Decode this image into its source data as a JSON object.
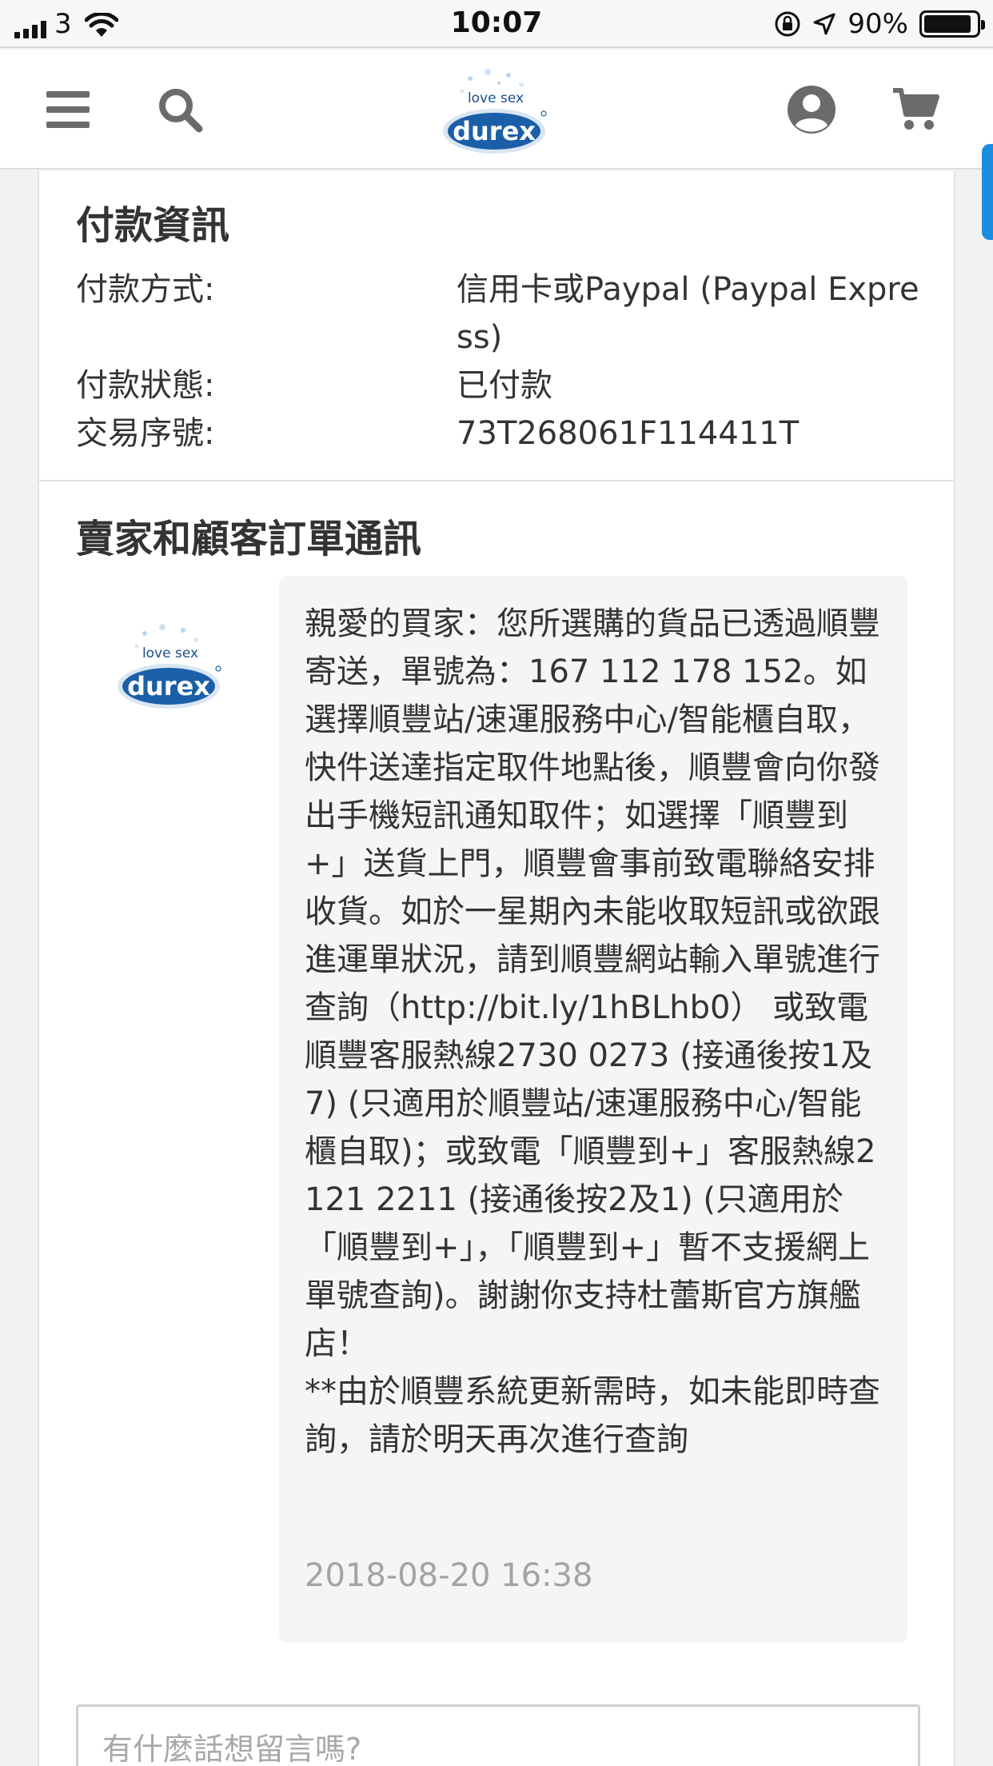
{
  "status_bar": {
    "carrier": "3",
    "time": "10:07",
    "battery_percent": "90%",
    "battery_level": 0.9
  },
  "header": {
    "logo": {
      "top_text": "love sex",
      "brand": "durex"
    },
    "icons": [
      "menu-icon",
      "search-icon",
      "account-icon",
      "cart-icon"
    ]
  },
  "payment": {
    "title": "付款資訊",
    "rows": [
      {
        "label": "付款方式:",
        "value": "信用卡或Paypal (Paypal Express)"
      },
      {
        "label": "付款狀態:",
        "value": "已付款"
      },
      {
        "label": "交易序號:",
        "value": "73T268061F114411T"
      }
    ]
  },
  "messages": {
    "title": "賣家和顧客訂單通訊",
    "avatar": {
      "top_text": "love sex",
      "brand": "durex"
    },
    "items": [
      {
        "text": " 親愛的買家：您所選購的貨品已透過順豐寄送，單號為：167 112 178 152。如選擇順豐站/速運服務中心/智能櫃自取，快件送達指定取件地點後，順豐會向你發出手機短訊通知取件；如選擇「順豐到+」送貨上門，順豐會事前致電聯絡安排收貨。如於一星期內未能收取短訊或欲跟進運單狀況，請到順豐網站輸入單號進行查詢（http://bit.ly/1hBLhb0） 或致電順豐客服熱線2730 0273 (接通後按1及7) (只適用於順豐站/速運服務中心/智能櫃自取)；或致電「順豐到+」客服熱線2121 2211 (接通後按2及1) (只適用於「順豐到+」，「順豐到+」暫不支援網上單號查詢)。謝謝你支持杜蕾斯官方旗艦店！\n**由於順豐系統更新需時，如未能即時查詢，請於明天再次進行查詢",
        "time": "2018-08-20 16:38"
      }
    ]
  },
  "comment": {
    "placeholder": "有什麼話想留言嗎?"
  },
  "colors": {
    "brand_blue": "#1b5fa8",
    "side_tab": "#1a8fe0",
    "bubble_bg": "#f5f5f5"
  }
}
